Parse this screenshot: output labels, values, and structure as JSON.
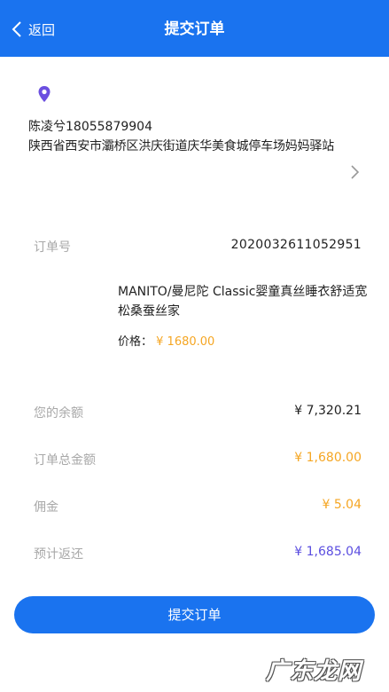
{
  "header": {
    "back_label": "返回",
    "title": "提交订单"
  },
  "address": {
    "icon": "location-pin-icon",
    "name_phone": "陈凌兮18055879904",
    "address_line": "陕西省西安市灞桥区洪庆街道庆华美食城停车场妈妈驿站"
  },
  "order": {
    "number_label": "订单号",
    "number_value": "2020032611052951",
    "product_name": "MANITO/曼尼陀 Classic婴童真丝睡衣舒适宽松桑蚕丝家",
    "price_label": "价格：",
    "price_value": "¥ 1680.00"
  },
  "summary": {
    "balance_label": "您的余额",
    "balance_value": "¥ 7,320.21",
    "total_label": "订单总金额",
    "total_value": "¥ 1,680.00",
    "commission_label": "佣金",
    "commission_value": "¥ 5.04",
    "rebate_label": "预计返还",
    "rebate_value": "¥ 1,685.04"
  },
  "submit_label": "提交订单",
  "watermark": "广东龙网",
  "colors": {
    "primary": "#1a73ef",
    "orange": "#f5a623",
    "purple": "#5b4ee0",
    "pin": "#6b4fe0",
    "label_gray": "#a8a8a8"
  }
}
